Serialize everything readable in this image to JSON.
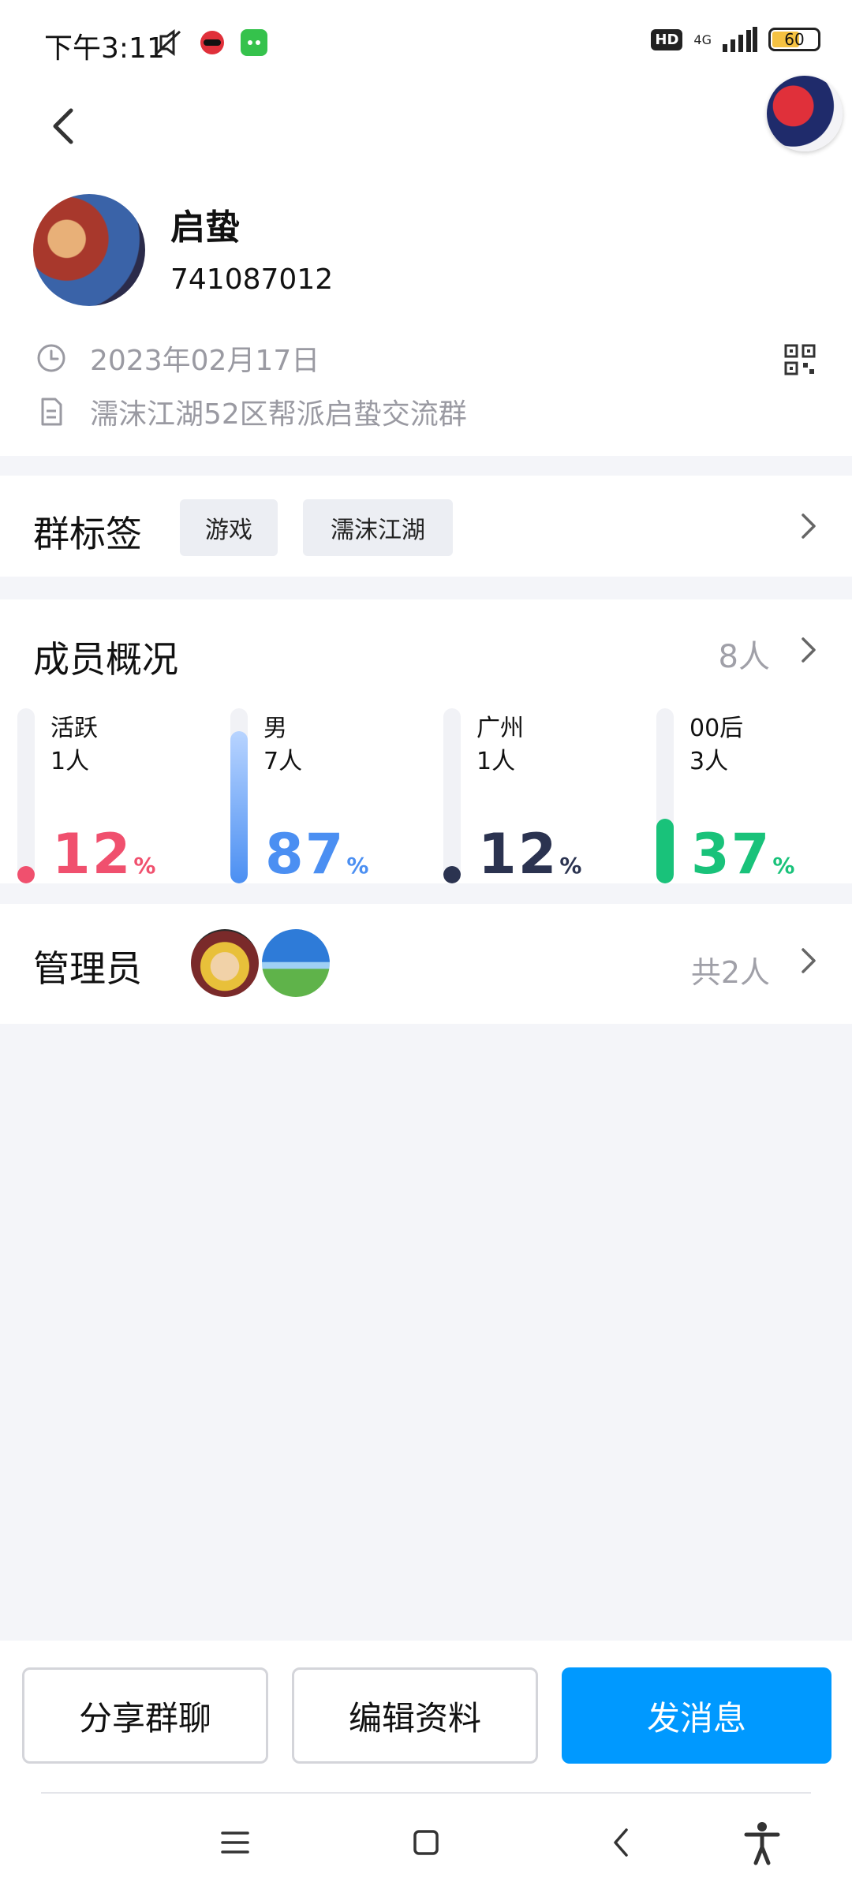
{
  "status_bar": {
    "time": "下午3:11",
    "hd": "HD",
    "network": "4G",
    "battery": "60",
    "battery_level": 0.6
  },
  "header": {
    "back_icon": "chevron-left-icon",
    "avatar_icon": "user-avatar"
  },
  "group": {
    "name": "启蛰",
    "id": "741087012",
    "created_date": "2023年02月17日",
    "description": "濡沫江湖52区帮派启蛰交流群"
  },
  "tags": {
    "title": "群标签",
    "items": [
      "游戏",
      "濡沫江湖"
    ]
  },
  "members": {
    "title": "成员概况",
    "count": "8人",
    "stats": [
      {
        "label": "活跃",
        "count": "1人",
        "percent": "12",
        "pct_sign": "%",
        "fraction": 0.12,
        "color": "#f0506e"
      },
      {
        "label": "男",
        "count": "7人",
        "percent": "87",
        "pct_sign": "%",
        "fraction": 0.87,
        "color": "#4b8ff2"
      },
      {
        "label": "广州",
        "count": "1人",
        "percent": "12",
        "pct_sign": "%",
        "fraction": 0.12,
        "color": "#2b3350"
      },
      {
        "label": "00后",
        "count": "3人",
        "percent": "37",
        "pct_sign": "%",
        "fraction": 0.37,
        "color": "#19c27a"
      }
    ]
  },
  "admins": {
    "title": "管理员",
    "total": "共2人"
  },
  "actions": {
    "share": "分享群聊",
    "edit": "编辑资料",
    "message": "发消息"
  },
  "colors": {
    "primary": "#0099ff",
    "muted_text": "#9a9aa2",
    "background": "#f4f5f9"
  }
}
